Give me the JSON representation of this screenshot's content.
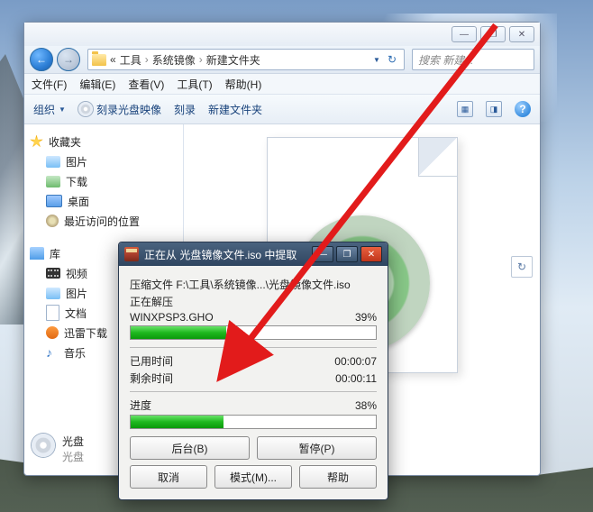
{
  "explorer": {
    "path": {
      "seg1": "工具",
      "seg2": "系统镜像",
      "seg3": "新建文件夹",
      "prefix": "« "
    },
    "search_placeholder": "搜索 新建...",
    "menu": {
      "file": "文件(F)",
      "edit": "编辑(E)",
      "view": "查看(V)",
      "tools": "工具(T)",
      "help": "帮助(H)"
    },
    "toolbar": {
      "organize": "组织",
      "burn_image": "刻录光盘映像",
      "burn": "刻录",
      "newfolder": "新建文件夹"
    },
    "tree": {
      "favorites": "收藏夹",
      "pictures": "图片",
      "downloads": "下载",
      "desktop": "桌面",
      "recent": "最近访问的位置",
      "libraries": "库",
      "video": "视频",
      "pictures2": "图片",
      "docs": "文档",
      "xunlei": "迅雷下载",
      "music": "音乐"
    },
    "item": {
      "name": "光盘",
      "sub": "光盘"
    }
  },
  "dialog": {
    "title": "正在从 光盘镜像文件.iso 中提取",
    "archive_line": "压缩文件 F:\\工具\\系统镜像...\\光盘镜像文件.iso",
    "extracting": "正在解压",
    "current_file": "WINXPSP3.GHO",
    "file_pct_label": "39%",
    "file_pct": 39,
    "elapsed_label": "已用时间",
    "elapsed_value": "00:00:07",
    "remaining_label": "剩余时间",
    "remaining_value": "00:00:11",
    "progress_label": "进度",
    "progress_pct_label": "38%",
    "progress_pct": 38,
    "buttons": {
      "background": "后台(B)",
      "pause": "暂停(P)",
      "cancel": "取消",
      "mode": "模式(M)...",
      "help": "帮助"
    }
  }
}
